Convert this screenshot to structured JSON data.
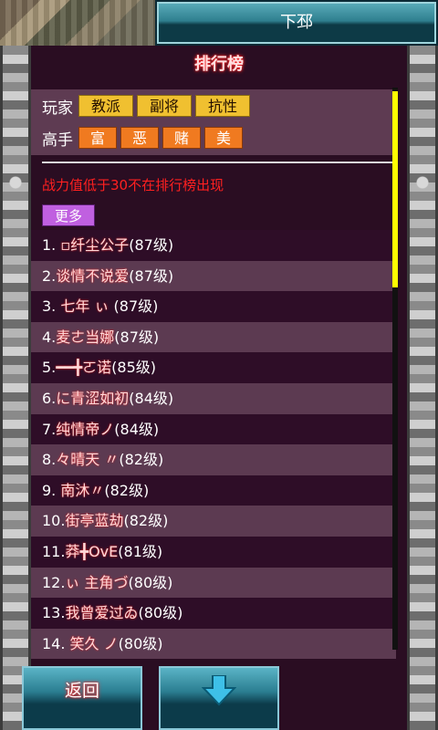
{
  "header": {
    "title": "下邳"
  },
  "heading": "排行榜",
  "filters": {
    "player_label": "玩家",
    "player_buttons": [
      "教派",
      "副将",
      "抗性"
    ],
    "master_label": "高手",
    "master_buttons": [
      "富",
      "恶",
      "赌",
      "美"
    ]
  },
  "notice": "战力值低于30不在排行榜出现",
  "more_label": "更多",
  "ranking": [
    {
      "rank": "1.",
      "name": "▫纤尘公子",
      "level": "(87级)"
    },
    {
      "rank": "2.",
      "name": "谈情不说爱",
      "level": "(87级)"
    },
    {
      "rank": "3.",
      "name": "七年 ぃ",
      "level": "(87级)"
    },
    {
      "rank": "4.",
      "name": "麦ㄜ当娜",
      "level": "(87级)"
    },
    {
      "rank": "5.",
      "name": "━━╋ㄛ诺",
      "level": "(85级)"
    },
    {
      "rank": "6.",
      "name": "に青涩如初",
      "level": "(84级)"
    },
    {
      "rank": "7.",
      "name": "纯情帝ノ",
      "level": "(84级)"
    },
    {
      "rank": "8.",
      "name": "々晴天 〃",
      "level": "(82级)"
    },
    {
      "rank": "9.",
      "name": "南沐〃",
      "level": "(82级)"
    },
    {
      "rank": "10.",
      "name": "街亭蓝劫",
      "level": "(82级)"
    },
    {
      "rank": "11.",
      "name": "莽╋OvE",
      "level": "(81级)"
    },
    {
      "rank": "12.",
      "name": "ぃ 主角づ",
      "level": "(80级)"
    },
    {
      "rank": "13.",
      "name": "我曾爱过ゐ",
      "level": "(80级)"
    },
    {
      "rank": "14.",
      "name": "笑久 ノ",
      "level": "(80级)"
    }
  ],
  "buttons": {
    "back": "返回",
    "down_icon": "down-arrow-icon"
  },
  "colors": {
    "accent_yellow": "#f0c030",
    "accent_orange": "#f07a20",
    "notice_red": "#ff2020",
    "more_purple": "#c060e0"
  }
}
